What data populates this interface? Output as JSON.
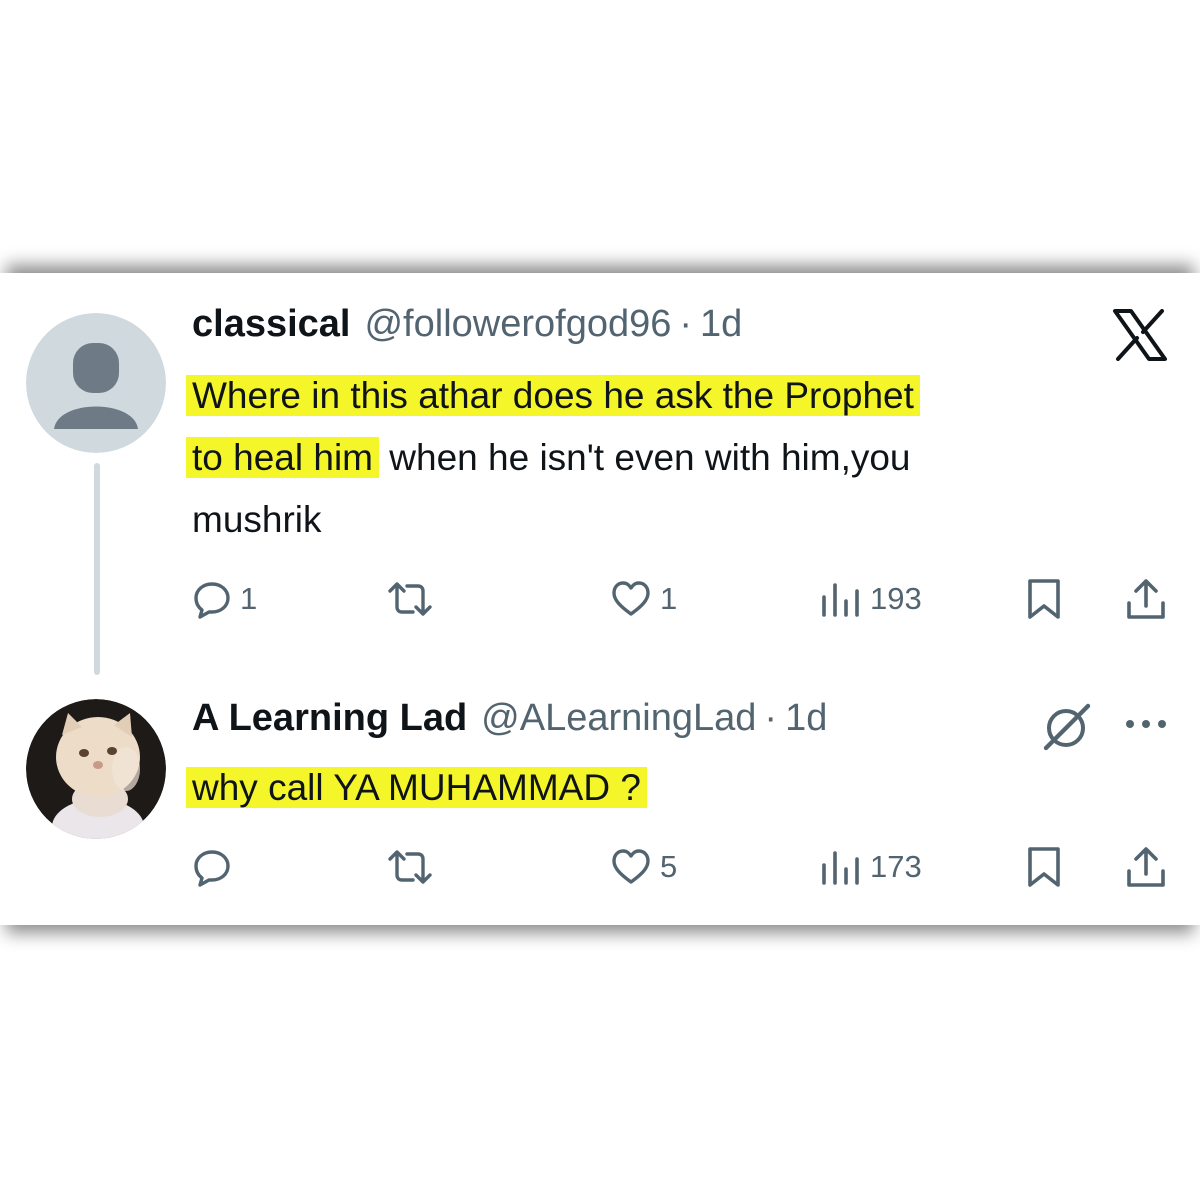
{
  "tweets": [
    {
      "display_name": "classical",
      "handle": "@followerofgod96",
      "separator": "·",
      "time": "1d",
      "text_line1": "Where in this  athar does he ask the Prophet",
      "text_highlight2": "to heal him",
      "text_rest2": " when he isn't even with him,you",
      "text_line3": "mushrik",
      "replies": "1",
      "reposts": "",
      "likes": "1",
      "views": "193"
    },
    {
      "display_name": "A Learning Lad",
      "handle": "@ALearningLad",
      "separator": "·",
      "time": "1d",
      "text_line1": "why call YA MUHAMMAD ?",
      "replies": "",
      "reposts": "",
      "likes": "5",
      "views": "173"
    }
  ],
  "colors": {
    "highlight": "#f5f62a",
    "secondary_text": "#536471",
    "primary_text": "#0f1419"
  },
  "icons": [
    "x-logo-icon",
    "grok-icon",
    "more-icon",
    "reply-icon",
    "repost-icon",
    "like-icon",
    "views-icon",
    "bookmark-icon",
    "share-icon"
  ]
}
